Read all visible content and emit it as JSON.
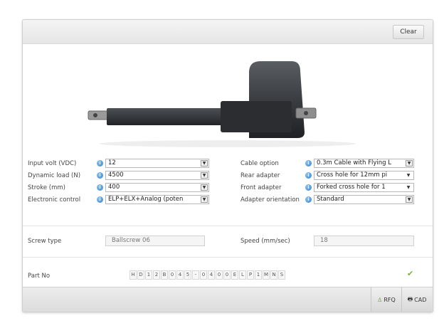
{
  "header": {
    "clear_label": "Clear"
  },
  "form": {
    "left": [
      {
        "label": "Input volt (VDC)",
        "value": "12"
      },
      {
        "label": "Dynamic load (N)",
        "value": "4500"
      },
      {
        "label": "Stroke (mm)",
        "value": "400"
      },
      {
        "label": "Electronic control",
        "value": "ELP+ELX+Analog (poten"
      }
    ],
    "right": [
      {
        "label": "Cable option",
        "value": "0.3m Cable with Flying L"
      },
      {
        "label": "Rear adapter",
        "value": "Cross hole for 12mm pi"
      },
      {
        "label": "Front adapter",
        "value": "Forked cross hole for 1"
      },
      {
        "label": "Adapter orientation",
        "value": "Standard"
      }
    ]
  },
  "outputs": {
    "screw_type_label": "Screw type",
    "screw_type_value": "Ballscrew 06",
    "speed_label": "Speed (mm/sec)",
    "speed_value": "18"
  },
  "part": {
    "label": "Part No",
    "chars": [
      "H",
      "D",
      "1",
      "2",
      "B",
      "0",
      "4",
      "5",
      "-",
      "0",
      "4",
      "0",
      "0",
      "E",
      "L",
      "P",
      "1",
      "M",
      "N",
      "S"
    ]
  },
  "footer": {
    "rfq_label": "RFQ",
    "cad_label": "CAD"
  },
  "icons": {
    "info": "info-icon",
    "check": "check-icon",
    "rfq": "rfq-icon",
    "cad": "cad-icon"
  },
  "colors": {
    "info_blue": "#2f7fcf",
    "check_green": "#7fb03a"
  }
}
